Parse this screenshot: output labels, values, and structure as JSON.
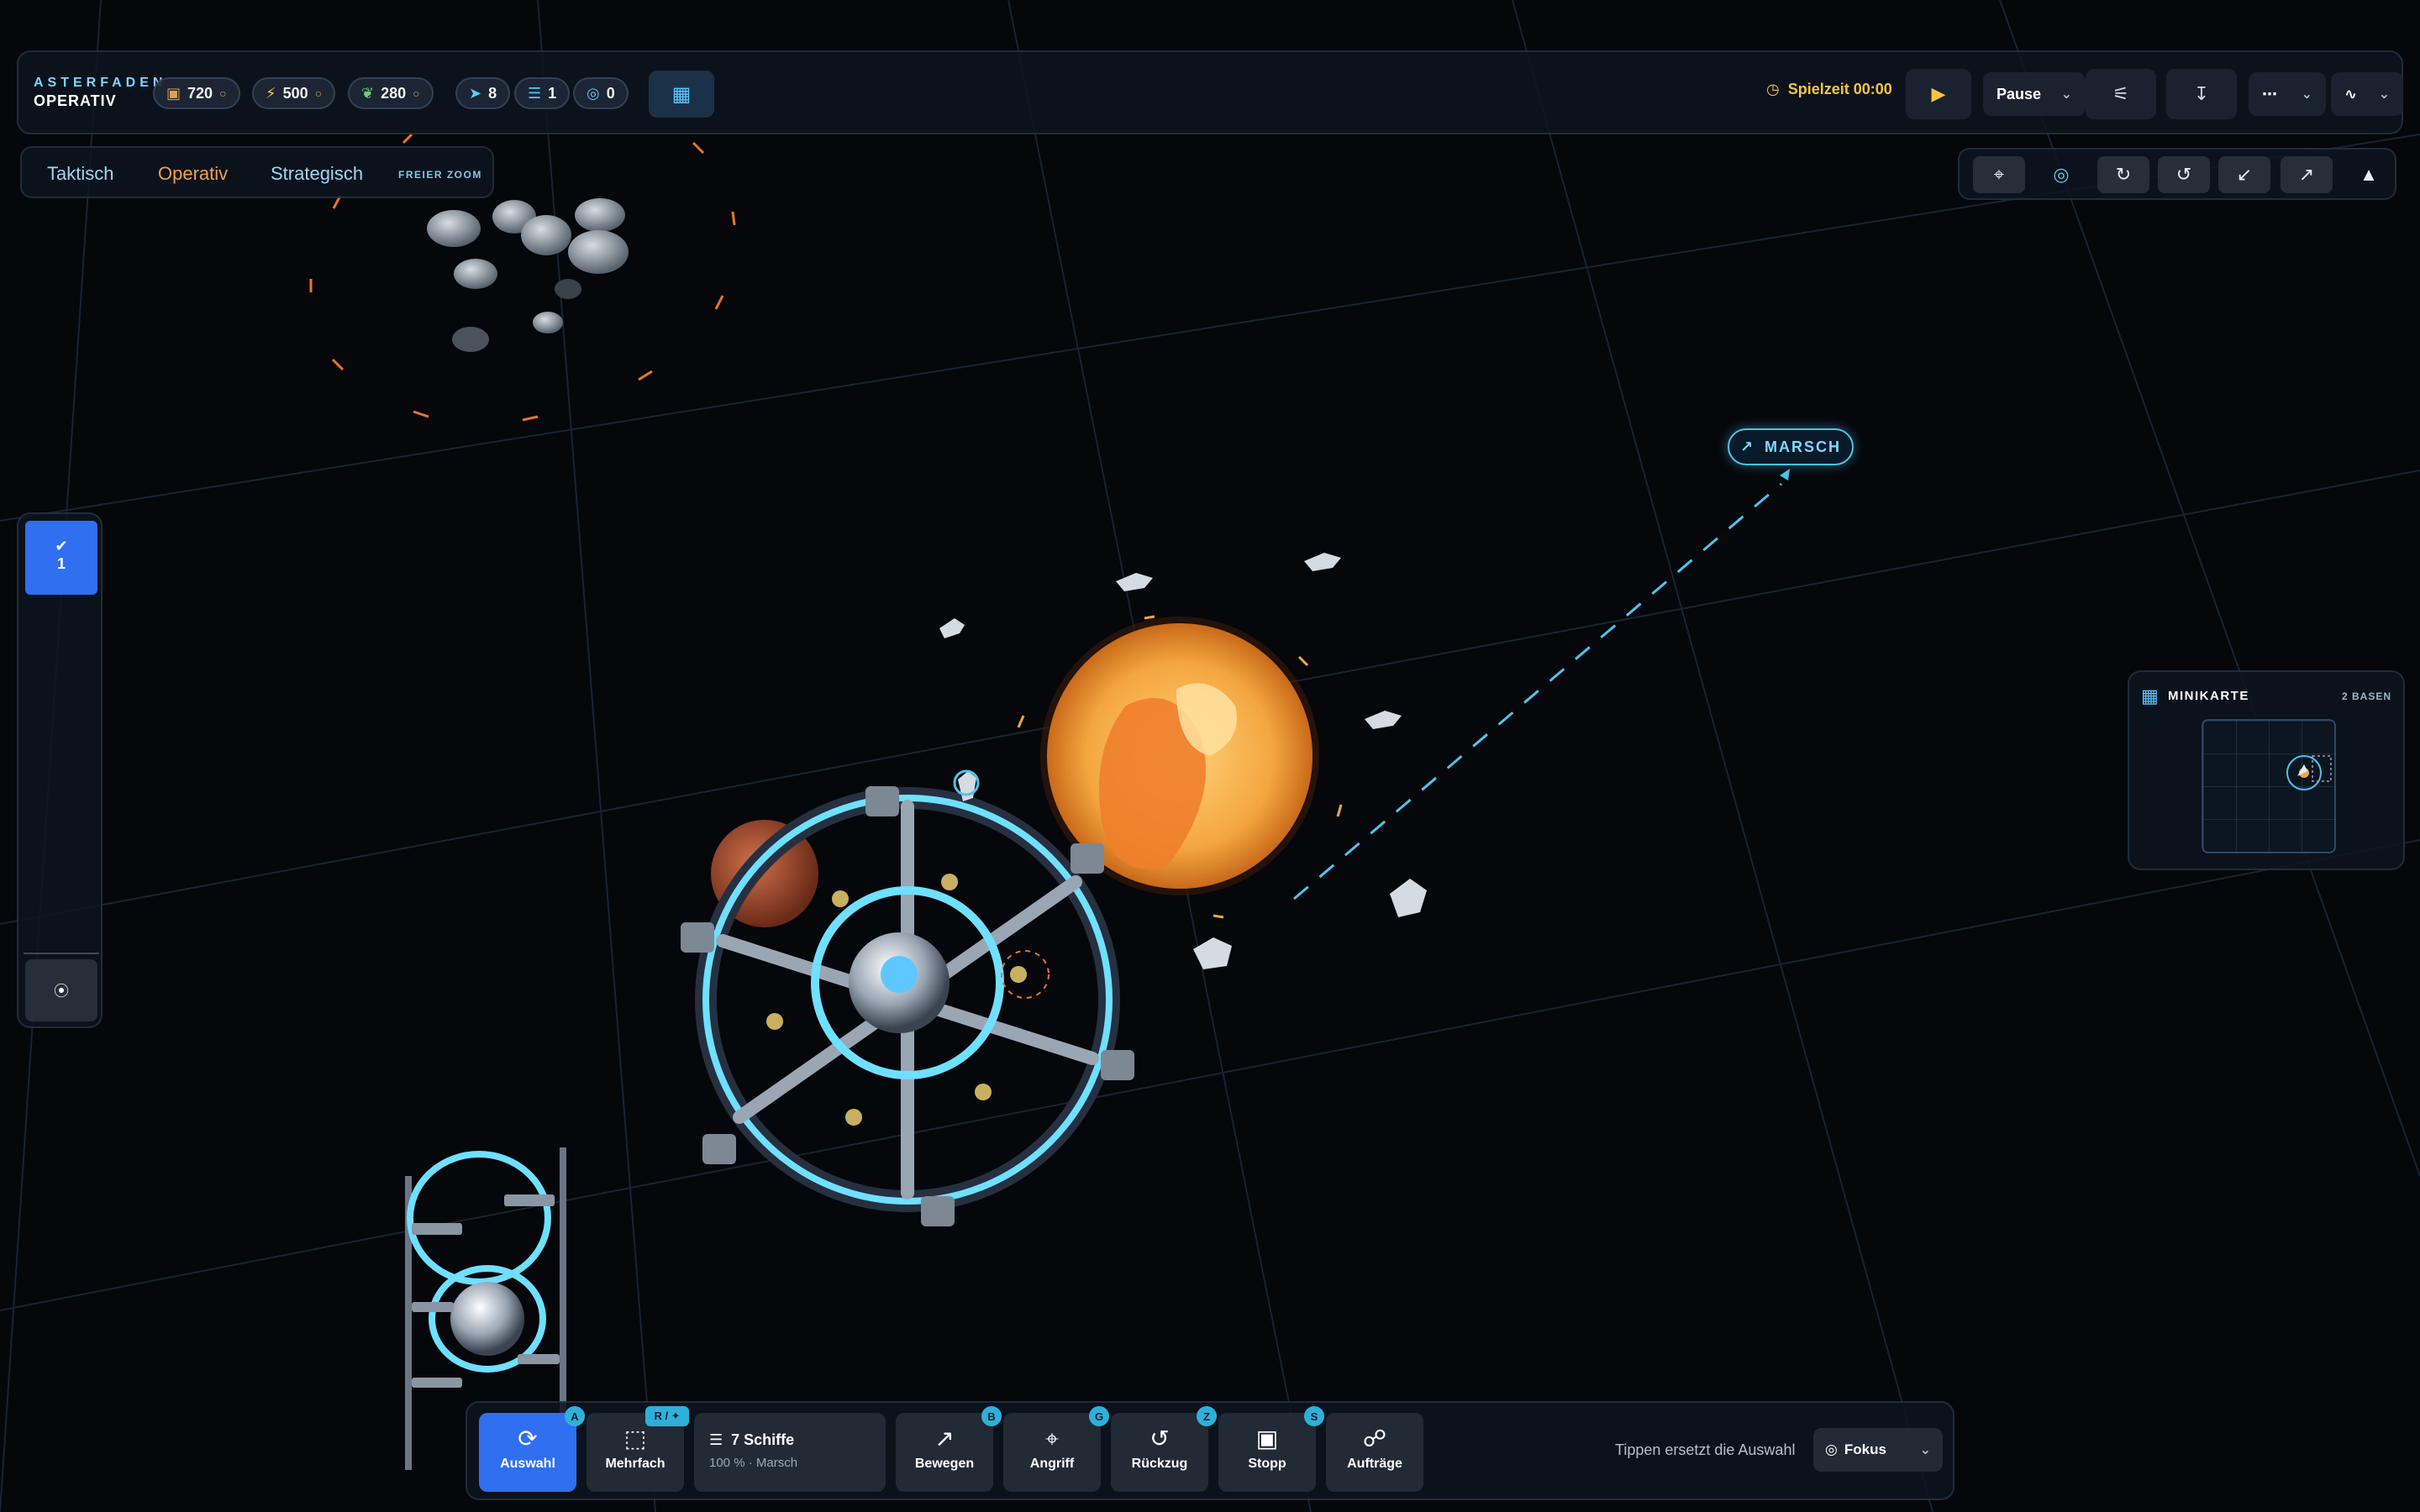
{
  "brand": {
    "line1": "ASTERFADEN",
    "line2": "OPERATIV"
  },
  "resources": [
    {
      "icon": "crate-icon",
      "value": "720",
      "color": "#e0a050"
    },
    {
      "icon": "bolt-icon",
      "value": "500",
      "color": "#f5c542"
    },
    {
      "icon": "leaf-icon",
      "value": "280",
      "color": "#6fcf70"
    },
    {
      "icon": "fleet-icon",
      "value": "8",
      "color": "#5cc8ff"
    },
    {
      "icon": "layers-icon",
      "value": "1",
      "color": "#5cc8ff"
    },
    {
      "icon": "target-icon",
      "value": "0",
      "color": "#5cc8ff"
    }
  ],
  "timer": {
    "label": "Spielzeit 00:00"
  },
  "speed": {
    "selected": "Pause"
  },
  "zoom_tabs": {
    "taktisch": "Taktisch",
    "operativ": "Operativ",
    "strategisch": "Strategisch",
    "hint": "FREIER ZOOM",
    "active": "Operativ"
  },
  "left_rail": {
    "group_number": "1"
  },
  "waypoint": {
    "label": "MARSCH"
  },
  "minimap": {
    "title": "MINIKARTE",
    "count": "2 BASEN"
  },
  "bottom": {
    "auswahl": {
      "label": "Auswahl",
      "hotkey": "A"
    },
    "mehrfach": {
      "label": "Mehrfach",
      "hotkey": "R / ✦"
    },
    "ships": {
      "title": "7 Schiffe",
      "sub": "100 % · Marsch"
    },
    "bewegen": {
      "label": "Bewegen",
      "hotkey": "B"
    },
    "angriff": {
      "label": "Angriff",
      "hotkey": "G"
    },
    "rueckzug": {
      "label": "Rückzug",
      "hotkey": "Z"
    },
    "stopp": {
      "label": "Stopp",
      "hotkey": "S"
    },
    "auftraege": {
      "label": "Aufträge"
    },
    "hint": "Tippen ersetzt die Auswahl",
    "focus": "Fokus"
  },
  "colors": {
    "accent": "#4fc3ec",
    "active": "#2f6ff0",
    "sun": "#f4a640",
    "warning": "#e0a050"
  }
}
